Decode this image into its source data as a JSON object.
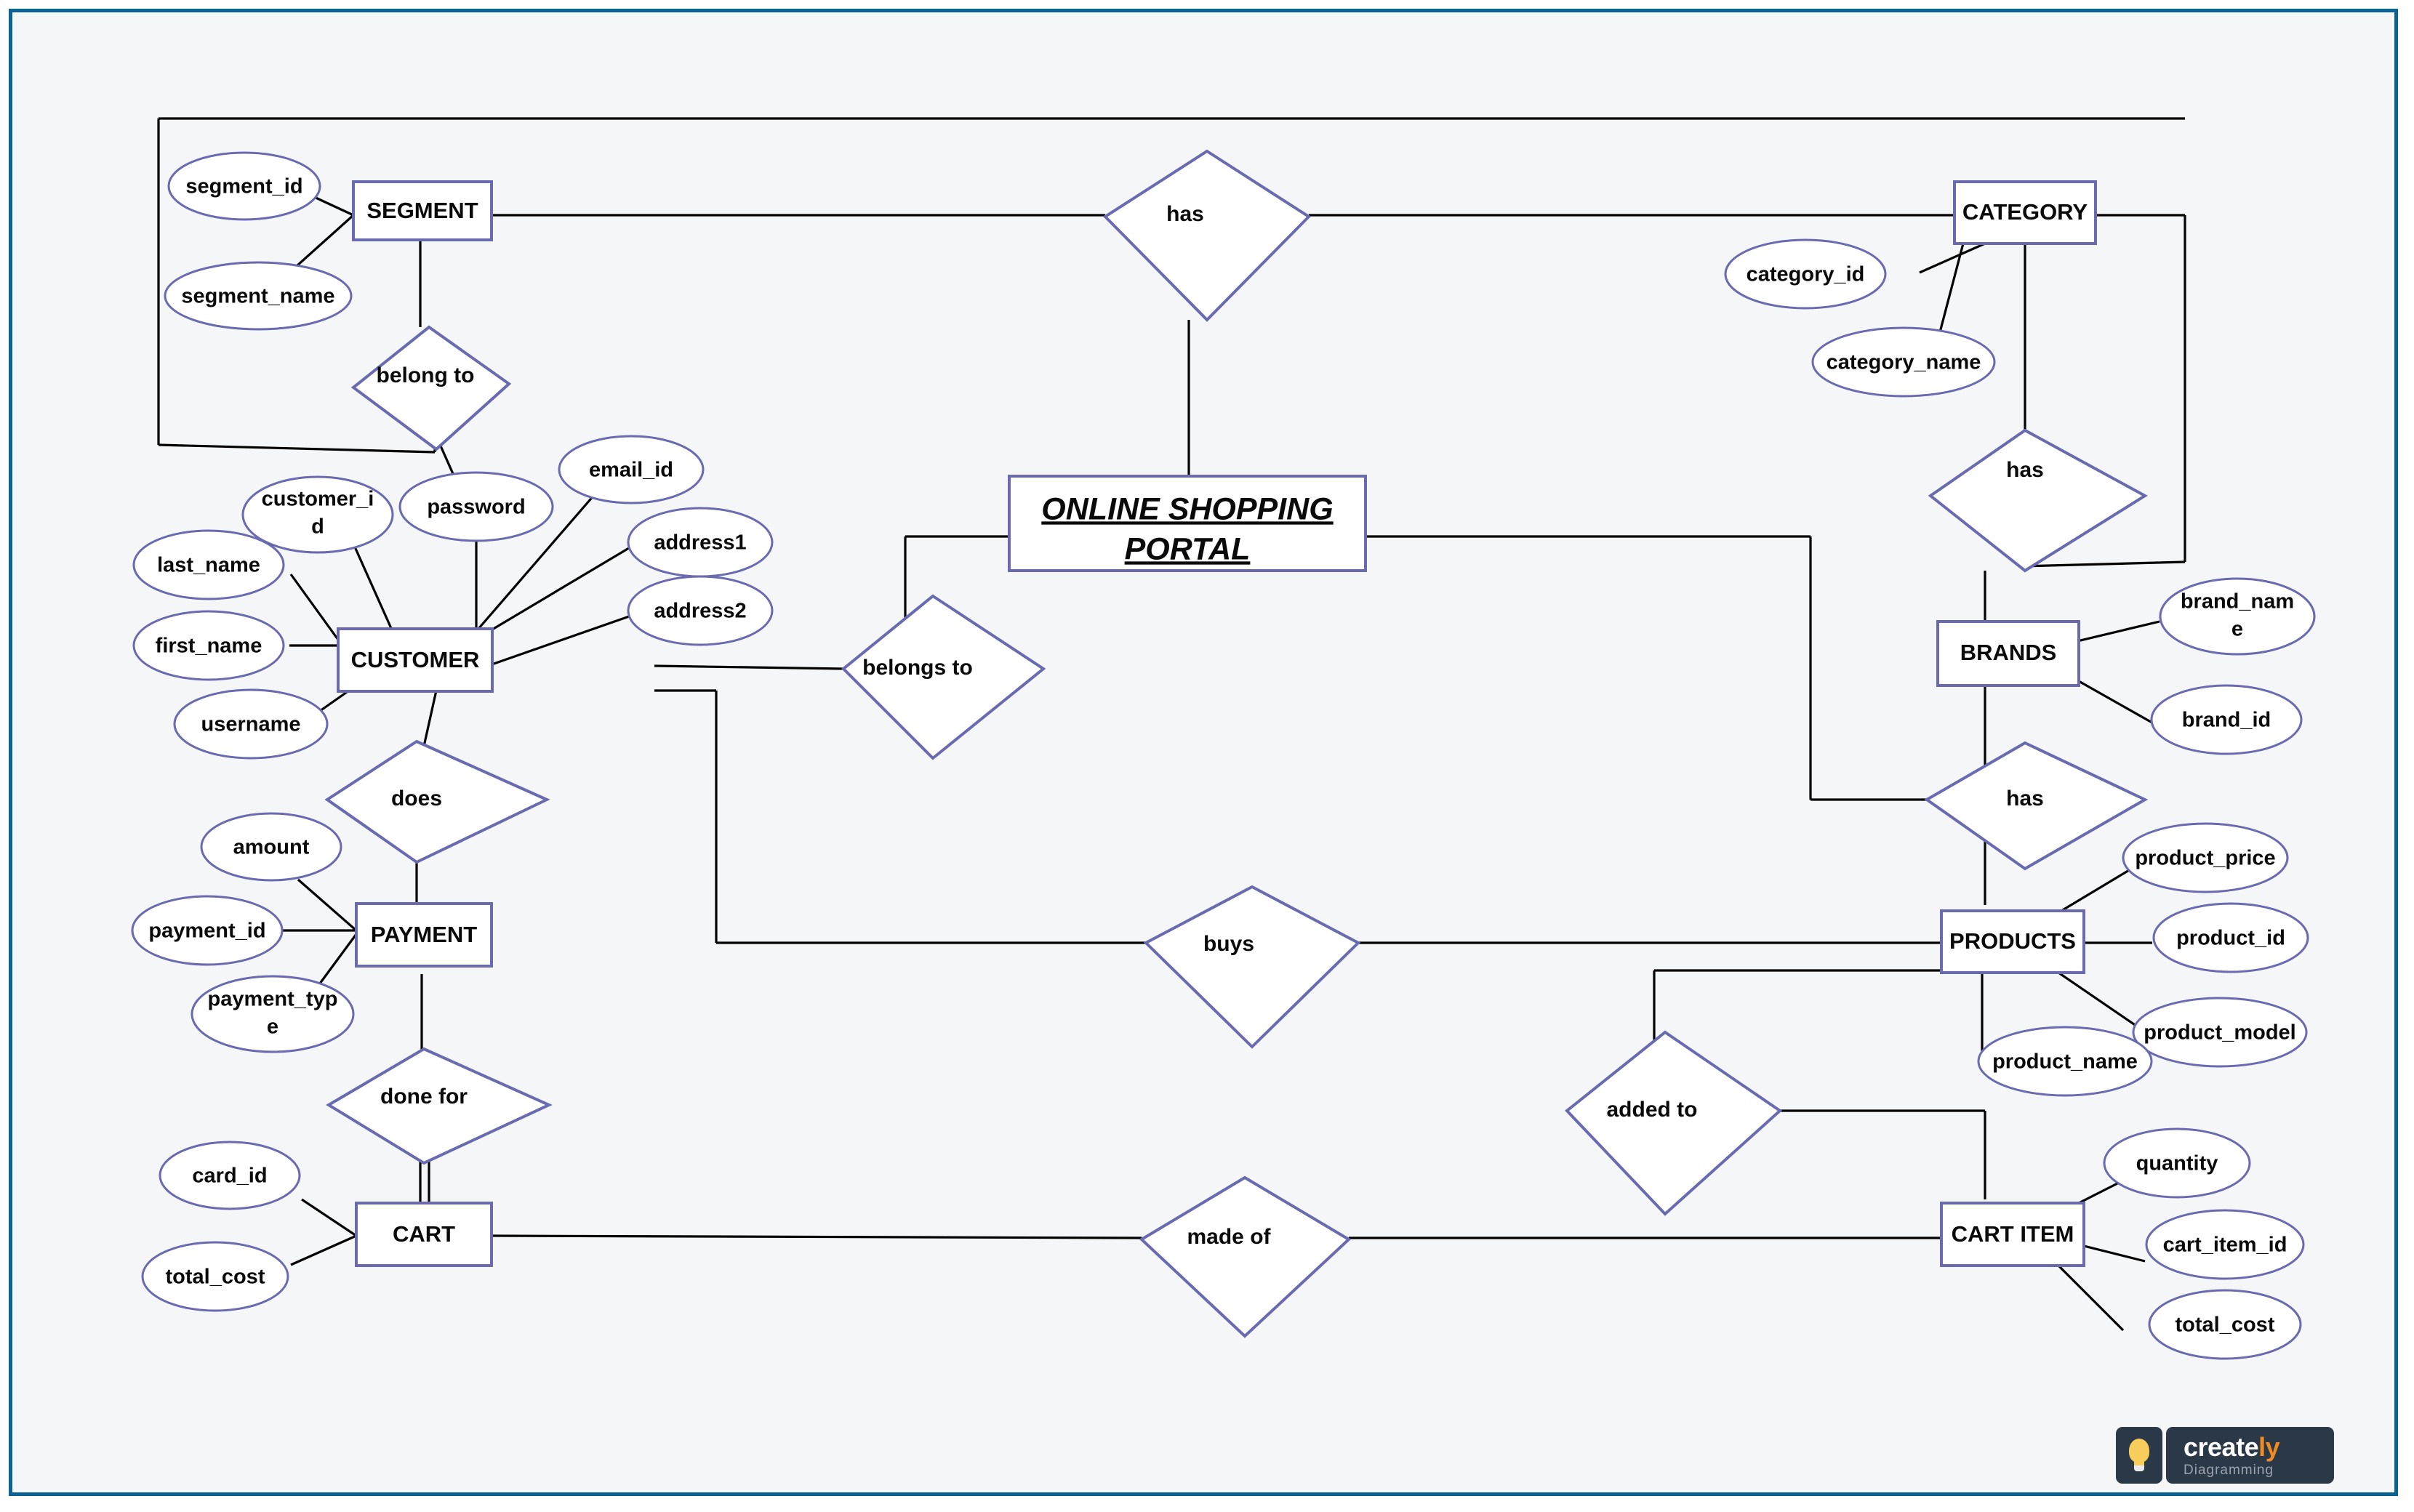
{
  "diagram": {
    "title": "ONLINE SHOPPING PORTAL",
    "colors": {
      "shape_stroke": "#6a6ab0",
      "connector": "#000000",
      "canvas_bg": "#f5f6f7",
      "frame_border": "#0a6394",
      "logo_bg": "#2b3847",
      "logo_accent": "#f08a24",
      "bulb": "#f7ce5b"
    },
    "entities": [
      {
        "id": "segment",
        "label": "SEGMENT"
      },
      {
        "id": "customer",
        "label": "CUSTOMER"
      },
      {
        "id": "payment",
        "label": "PAYMENT"
      },
      {
        "id": "cart",
        "label": "CART"
      },
      {
        "id": "portal",
        "label": "ONLINE SHOPPING PORTAL"
      },
      {
        "id": "category",
        "label": "CATEGORY"
      },
      {
        "id": "brands",
        "label": "BRANDS"
      },
      {
        "id": "products",
        "label": "PRODUCTS"
      },
      {
        "id": "cart_item",
        "label": "CART ITEM"
      }
    ],
    "relationships": [
      {
        "id": "has_category",
        "label": "has"
      },
      {
        "id": "belong_to",
        "label": "belong to"
      },
      {
        "id": "belongs_to",
        "label": "belongs to"
      },
      {
        "id": "does",
        "label": "does"
      },
      {
        "id": "done_for",
        "label": "done for"
      },
      {
        "id": "buys",
        "label": "buys"
      },
      {
        "id": "made_of",
        "label": "made of"
      },
      {
        "id": "has_brands",
        "label": "has"
      },
      {
        "id": "has_products",
        "label": "has"
      },
      {
        "id": "added_to",
        "label": "added to"
      }
    ],
    "attributes": {
      "segment": [
        "segment_id",
        "segment_name"
      ],
      "customer": [
        "customer_id",
        "password",
        "email_id",
        "address1",
        "address2",
        "last_name",
        "first_name",
        "username"
      ],
      "payment": [
        "amount",
        "payment_id",
        "payment_type"
      ],
      "cart": [
        "card_id",
        "total_cost"
      ],
      "category": [
        "category_id",
        "category_name"
      ],
      "brands": [
        "brand_name",
        "brand_id"
      ],
      "products": [
        "product_price",
        "product_id",
        "product_model",
        "product_name"
      ],
      "cart_item": [
        "quantity",
        "cart_item_id",
        "total_cost"
      ]
    },
    "attribute_display": {
      "customer_id": [
        "customer_i",
        "d"
      ],
      "payment_type": [
        "payment_typ",
        "e"
      ],
      "brand_name": [
        "brand_nam",
        "e"
      ]
    },
    "logo": {
      "word_white": "create",
      "word_accent": "ly",
      "tagline": "Diagramming",
      "icon": "lightbulb-icon"
    }
  }
}
